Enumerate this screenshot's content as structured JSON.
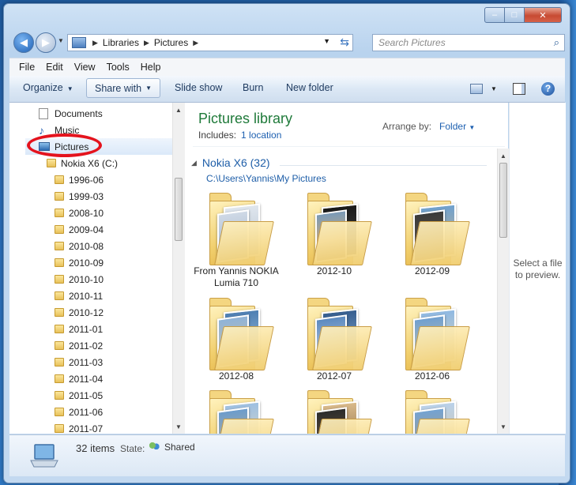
{
  "window_controls": {
    "minimize": "–",
    "maximize": "□",
    "close": "✕"
  },
  "address": {
    "crumbs": [
      "Libraries",
      "Pictures"
    ]
  },
  "search": {
    "placeholder": "Search Pictures"
  },
  "menu": [
    "File",
    "Edit",
    "View",
    "Tools",
    "Help"
  ],
  "toolbar": {
    "organize": "Organize",
    "share_with": "Share with",
    "slide_show": "Slide show",
    "burn": "Burn",
    "new_folder": "New folder"
  },
  "nav": {
    "documents": "Documents",
    "music": "Music",
    "pictures": "Pictures",
    "drive": "Nokia X6 (C:)",
    "folders": [
      "1996-06",
      "1999-03",
      "2008-10",
      "2009-04",
      "2010-08",
      "2010-09",
      "2010-10",
      "2010-11",
      "2010-12",
      "2011-01",
      "2011-02",
      "2011-03",
      "2011-04",
      "2011-05",
      "2011-06",
      "2011-07"
    ]
  },
  "library": {
    "title": "Pictures library",
    "includes_label": "Includes:",
    "includes_link": "1 location",
    "arrange_label": "Arrange by:",
    "arrange_value": "Folder",
    "group_name": "Nokia X6 (32)",
    "group_path": "C:\\Users\\Yannis\\My Pictures",
    "tiles": [
      {
        "label": "From Yannis NOKIA Lumia 710"
      },
      {
        "label": "2012-10"
      },
      {
        "label": "2012-09"
      },
      {
        "label": "2012-08"
      },
      {
        "label": "2012-07"
      },
      {
        "label": "2012-06"
      },
      {
        "label": ""
      },
      {
        "label": ""
      },
      {
        "label": ""
      }
    ]
  },
  "preview": {
    "text": "Select a file to preview."
  },
  "status": {
    "count": "32 items",
    "state_label": "State:",
    "state_value": "Shared"
  }
}
